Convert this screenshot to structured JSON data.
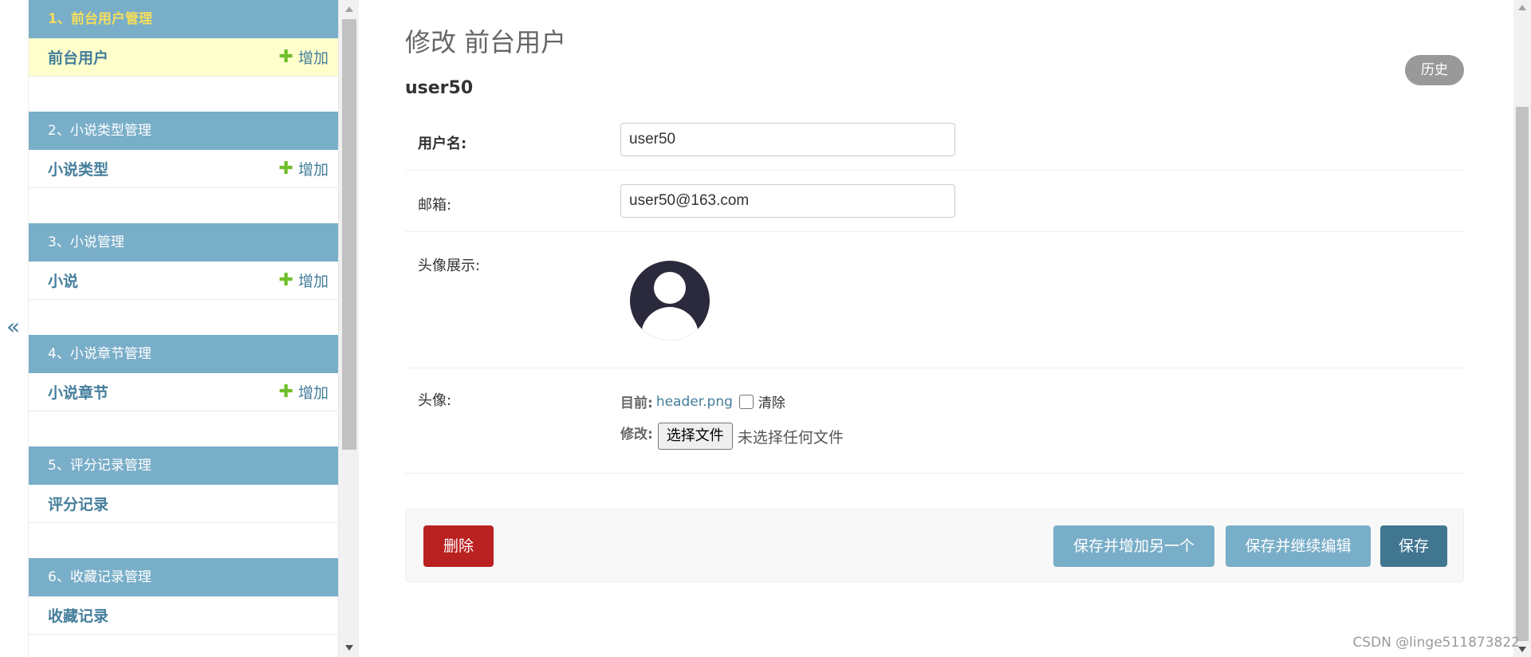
{
  "toggle": {
    "glyph": "«",
    "icon": "double-chevron-left-icon"
  },
  "sidebar": {
    "modules": [
      {
        "caption": "1、前台用户管理",
        "active": true,
        "row_label": "前台用户",
        "add_label": "增加",
        "has_add": true
      },
      {
        "caption": "2、小说类型管理",
        "active": false,
        "row_label": "小说类型",
        "add_label": "增加",
        "has_add": true
      },
      {
        "caption": "3、小说管理",
        "active": false,
        "row_label": "小说",
        "add_label": "增加",
        "has_add": true
      },
      {
        "caption": "4、小说章节管理",
        "active": false,
        "row_label": "小说章节",
        "add_label": "增加",
        "has_add": true
      },
      {
        "caption": "5、评分记录管理",
        "active": false,
        "row_label": "评分记录",
        "has_add": false
      },
      {
        "caption": "6、收藏记录管理",
        "active": false,
        "row_label": "收藏记录",
        "has_add": false
      }
    ],
    "plus_glyph": "✚"
  },
  "main": {
    "title": "修改 前台用户",
    "history_label": "历史",
    "object_name": "user50",
    "fields": {
      "username": {
        "label": "用户名:",
        "value": "user50"
      },
      "email": {
        "label": "邮箱:",
        "value": "user50@163.com"
      },
      "avatar_display": {
        "label": "头像展示:",
        "icon": "user-avatar-icon"
      },
      "avatar": {
        "label": "头像:",
        "current_label": "目前:",
        "current_file": "header.png",
        "clear_label": "清除",
        "change_label": "修改:",
        "choose_button": "选择文件",
        "no_file_text": "未选择任何文件"
      }
    },
    "actions": {
      "delete": "删除",
      "save_add_another": "保存并增加另一个",
      "save_continue": "保存并继续编辑",
      "save": "保存"
    }
  },
  "colors": {
    "module_caption_bg": "#79aec8",
    "active_caption_text": "#f5dd5d",
    "active_row_bg": "#ffffcc",
    "link": "#447e9b",
    "add_plus": "#70bf2b",
    "delete_btn": "#ba2121",
    "secondary_btn": "#79aec8",
    "primary_btn": "#417690",
    "history_btn": "#999999"
  },
  "watermark": "CSDN @linge511873822"
}
